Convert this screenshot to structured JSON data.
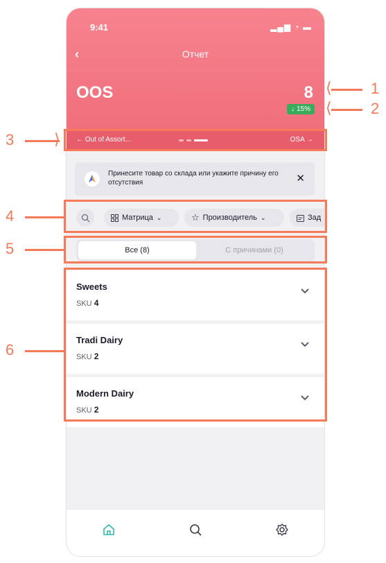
{
  "status": {
    "time": "9:41",
    "icons": "▂▄▆ ◔ ▬"
  },
  "header": {
    "back_icon": "‹",
    "title": "Отчет"
  },
  "metric": {
    "name": "OOS",
    "value": "8",
    "delta": "↓ 15%",
    "delta_color": "#3aab5a"
  },
  "carousel": {
    "prev": "← Out of Assort...",
    "next": "OSA →"
  },
  "banner": {
    "text": "Принесите товар со склада или укажите причину его отсутствия",
    "close": "✕"
  },
  "filters": {
    "chips": [
      {
        "label": "Матрица",
        "icon": "grid-icon"
      },
      {
        "label": "Производитель",
        "icon": "star-icon"
      },
      {
        "label": "Зад",
        "icon": "calendar-icon"
      }
    ]
  },
  "segments": {
    "all": "Все (8)",
    "with_reasons": "С причинами (0)"
  },
  "list": [
    {
      "name": "Sweets",
      "sku_label": "SKU",
      "sku": "4"
    },
    {
      "name": "Tradi Dairy",
      "sku_label": "SKU",
      "sku": "2"
    },
    {
      "name": "Modern Dairy",
      "sku_label": "SKU",
      "sku": "2"
    }
  ],
  "tabs": [
    "home-icon",
    "search-icon",
    "settings-icon"
  ],
  "annotations": [
    "1",
    "2",
    "3",
    "4",
    "5",
    "6"
  ],
  "colors": {
    "accent": "#ef6b79",
    "annotation": "#f47a59"
  }
}
